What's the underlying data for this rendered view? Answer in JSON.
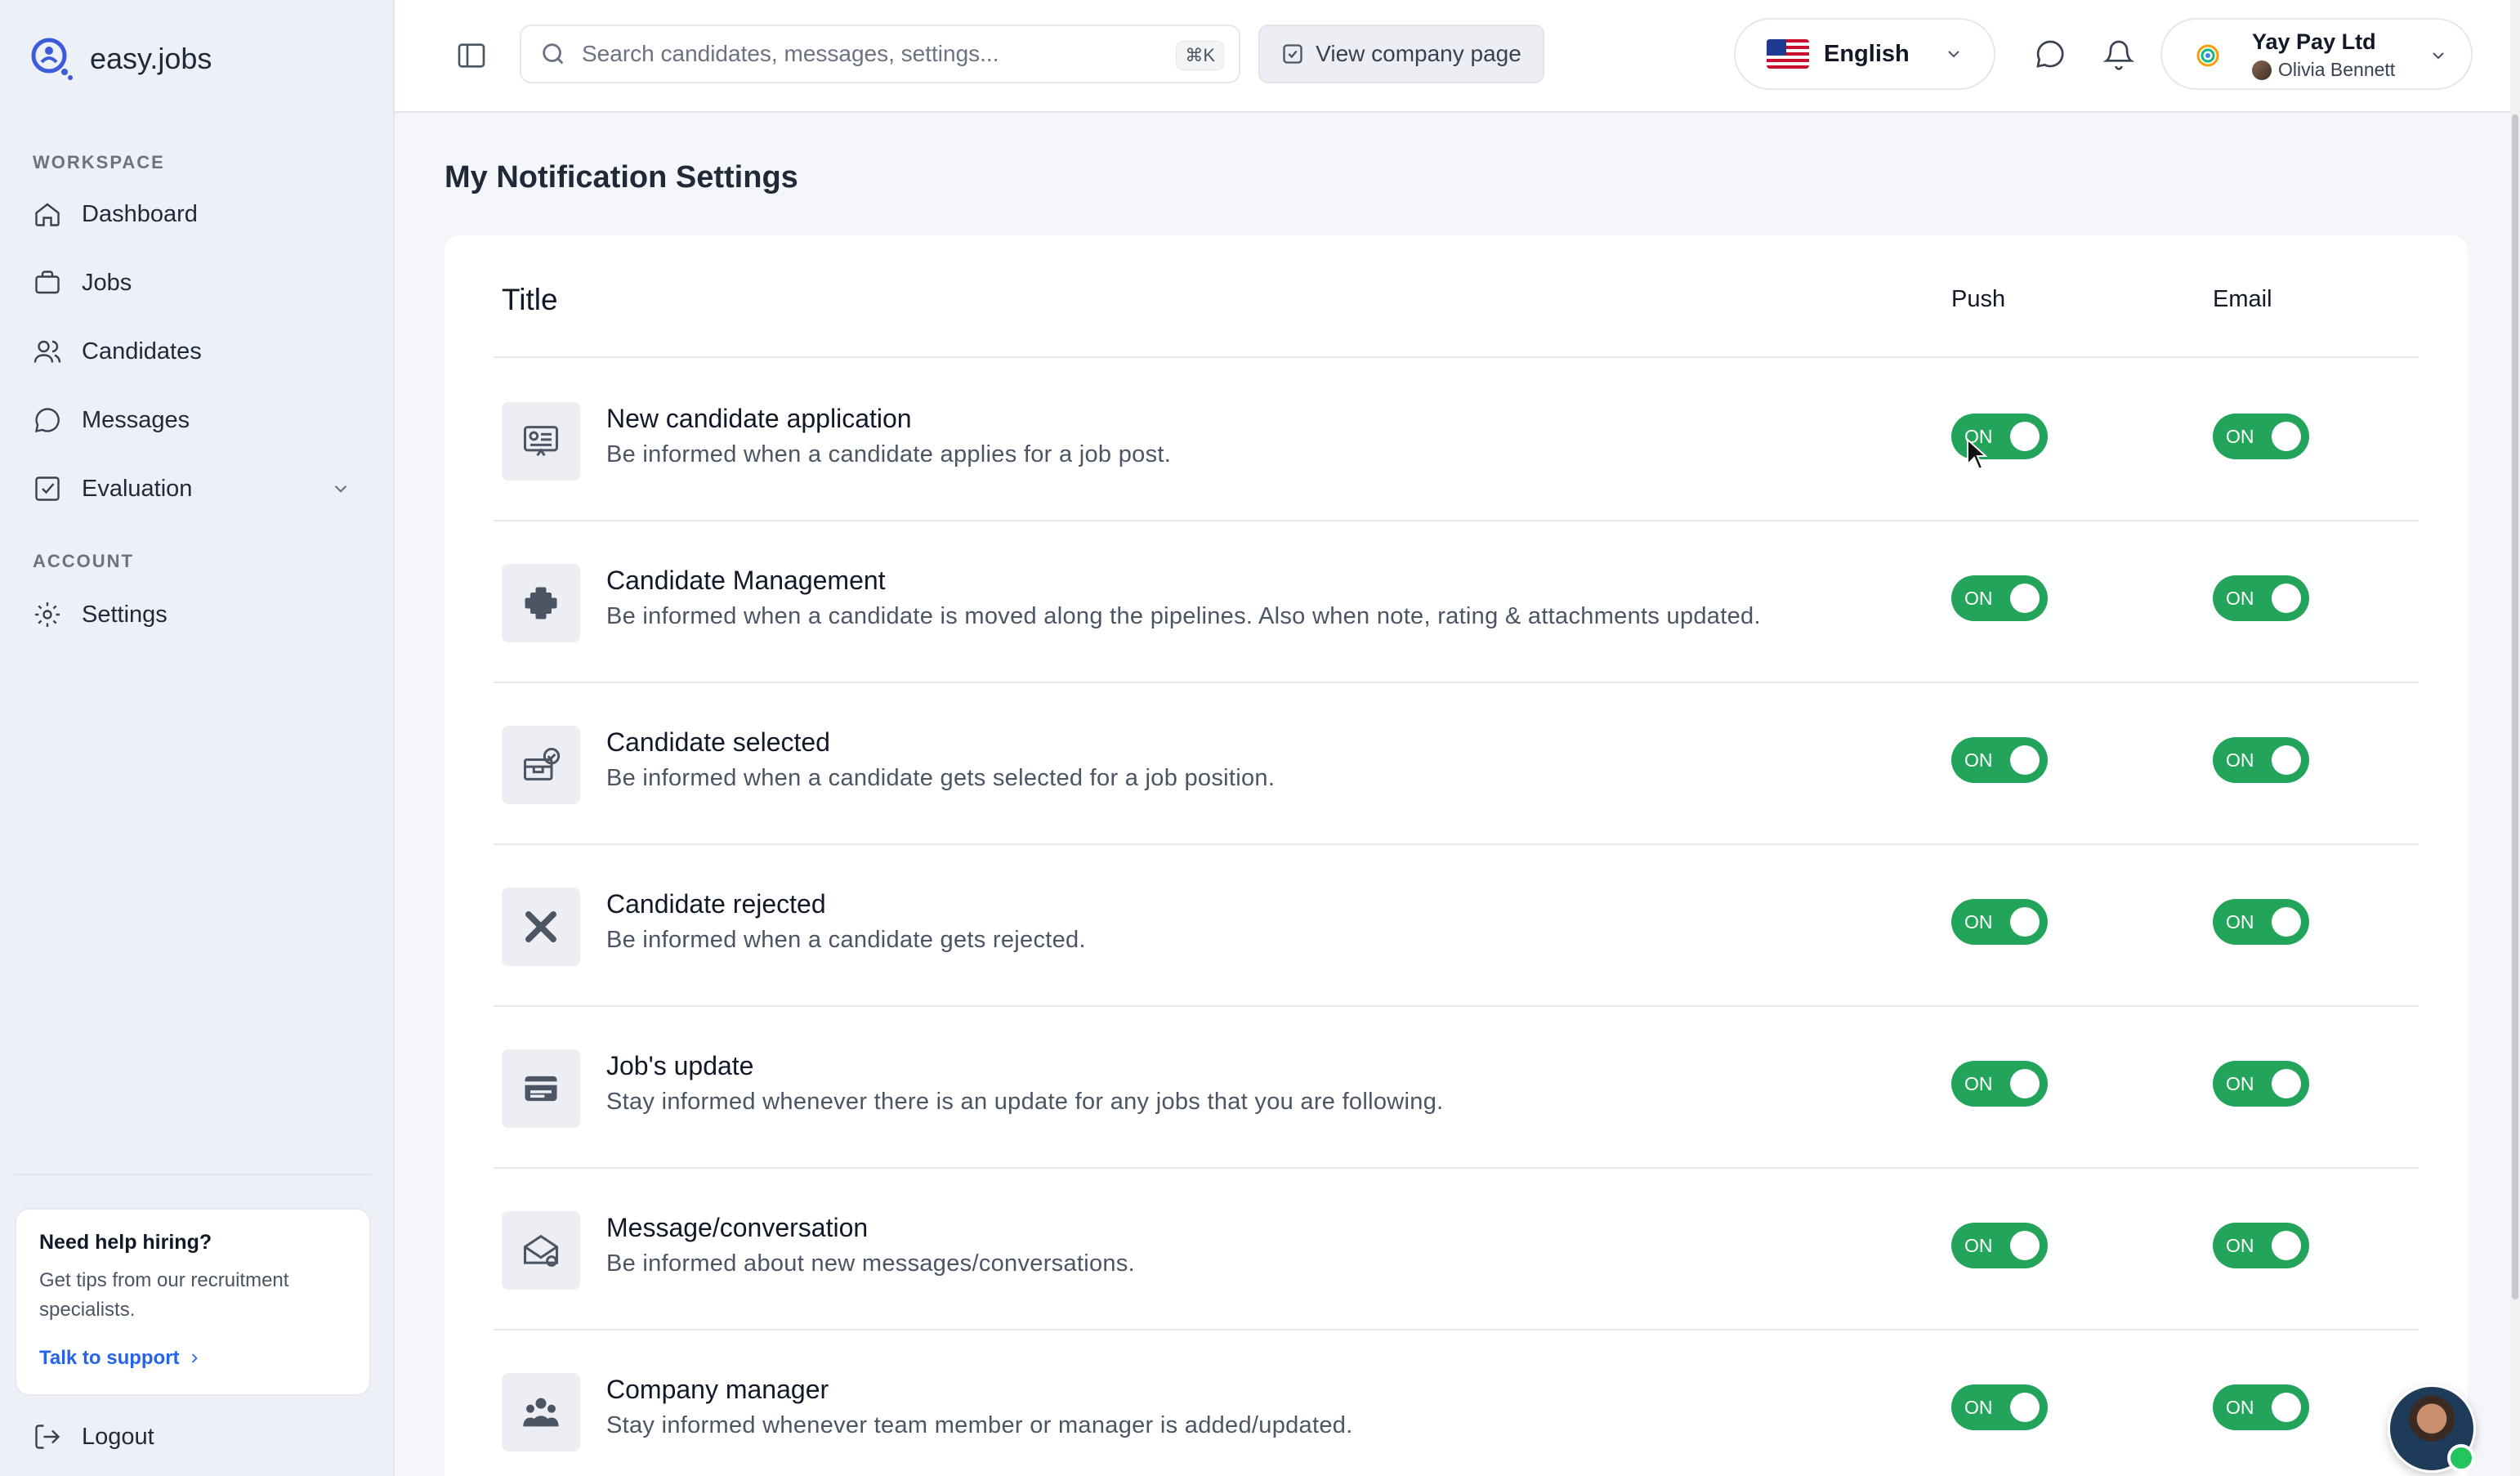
{
  "app": {
    "brand": "easy.jobs"
  },
  "sidebar": {
    "workspace_label": "WORKSPACE",
    "account_label": "ACCOUNT",
    "items": [
      {
        "label": "Dashboard",
        "icon": "home-icon"
      },
      {
        "label": "Jobs",
        "icon": "briefcase-icon"
      },
      {
        "label": "Candidates",
        "icon": "users-icon"
      },
      {
        "label": "Messages",
        "icon": "chat-icon"
      },
      {
        "label": "Evaluation",
        "icon": "checkbox-icon"
      },
      {
        "label": "Settings",
        "icon": "gear-icon"
      }
    ],
    "help": {
      "title": "Need help hiring?",
      "text": "Get tips from our recruitment specialists.",
      "link": "Talk to support"
    },
    "logout": "Logout"
  },
  "header": {
    "search_placeholder": "Search candidates, messages, settings...",
    "search_shortcut": "⌘K",
    "company_page_button": "View company page",
    "language": "English",
    "company_name": "Yay Pay Ltd",
    "user_name": "Olivia Bennett"
  },
  "main": {
    "title": "My Notification Settings",
    "columns": {
      "title": "Title",
      "push": "Push",
      "email": "Email"
    },
    "rows": [
      {
        "title": "New candidate application",
        "desc": "Be informed when a candidate applies for a job post.",
        "push": "ON",
        "email": "ON"
      },
      {
        "title": "Candidate Management",
        "desc": "Be informed when a candidate is moved along the pipelines. Also when note, rating & attachments updated.",
        "push": "ON",
        "email": "ON"
      },
      {
        "title": "Candidate selected",
        "desc": "Be informed when a candidate gets selected for a job position.",
        "push": "ON",
        "email": "ON"
      },
      {
        "title": "Candidate rejected",
        "desc": "Be informed when a candidate gets rejected.",
        "push": "ON",
        "email": "ON"
      },
      {
        "title": "Job's update",
        "desc": "Stay informed whenever there is an update for any jobs that you are following.",
        "push": "ON",
        "email": "ON"
      },
      {
        "title": "Message/conversation",
        "desc": "Be informed about new messages/conversations.",
        "push": "ON",
        "email": "ON"
      },
      {
        "title": "Company manager",
        "desc": "Stay informed whenever team member or manager is added/updated.",
        "push": "ON",
        "email": "ON"
      }
    ]
  },
  "colors": {
    "toggle_on": "#22a55b",
    "link": "#2563eb",
    "sidebar_bg": "#eef0f7"
  }
}
